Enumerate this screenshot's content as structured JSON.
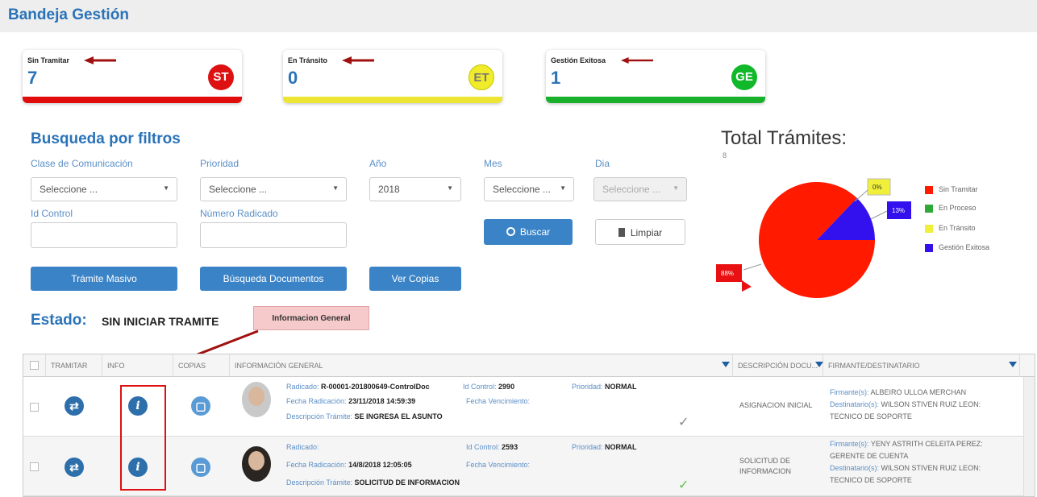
{
  "header": {
    "title": "Bandeja Gestión"
  },
  "cards": [
    {
      "label": "Sin Tramitar",
      "value": "7",
      "badge": "ST",
      "color": "#dd1111",
      "bar_color": "#e10d0d"
    },
    {
      "label": "En Tránsito",
      "value": "0",
      "badge": "ET",
      "color": "#f0ec2a",
      "bar_color": "#ece534"
    },
    {
      "label": "Gestión Exitosa",
      "value": "1",
      "badge": "GE",
      "color": "#11b82a",
      "bar_color": "#19b02c"
    }
  ],
  "filters": {
    "title": "Busqueda por filtros",
    "clase_label": "Clase de Comunicación",
    "clase_value": "Seleccione ...",
    "prioridad_label": "Prioridad",
    "prioridad_value": "Seleccione ...",
    "anio_label": "Año",
    "anio_value": "2018",
    "mes_label": "Mes",
    "mes_value": "Seleccione ...",
    "dia_label": "Dia",
    "dia_value": "Seleccione ...",
    "id_control_label": "Id Control",
    "numero_radicado_label": "Número Radicado",
    "buscar_label": "Buscar",
    "limpiar_label": "Limpiar",
    "tramite_masivo_label": "Trámite Masivo",
    "busqueda_docs_label": "Búsqueda Documentos",
    "ver_copias_label": "Ver Copias"
  },
  "estado": {
    "label": "Estado:",
    "value": "SIN INICIAR TRAMITE"
  },
  "info_tag": "Informacion General",
  "total": {
    "title": "Total Trámites:",
    "value": "8",
    "legend": [
      {
        "label": "Sin Tramitar",
        "color": "#ff1a00"
      },
      {
        "label": "En Proceso",
        "color": "#2ea836"
      },
      {
        "label": "En Tránsito",
        "color": "#f0f03a"
      },
      {
        "label": "Gestión Exitosa",
        "color": "#3311ee"
      }
    ],
    "slice_labels": {
      "sin_tramitar": "88%",
      "en_transito": "0%",
      "gestion_exitosa": "13%"
    },
    "chart_data": {
      "type": "pie",
      "categories": [
        "Sin Tramitar",
        "En Proceso",
        "En Tránsito",
        "Gestión Exitosa"
      ],
      "values": [
        88,
        0,
        0,
        13
      ]
    }
  },
  "grid": {
    "headers": [
      "TRAMITAR",
      "INFO",
      "COPIAS",
      "INFORMACIÓN GENERAL",
      "DESCRIPCIÓN DOCU...",
      "FIRMANTE/DESTINATARIO"
    ],
    "rows": [
      {
        "radicado_label": "Radicado:",
        "radicado_value": "R-00001-201800649-ControlDoc",
        "id_control_label": "Id Control:",
        "id_control_value": "2990",
        "prioridad_label": "Prioridad:",
        "prioridad_value": "NORMAL",
        "fecha_rad_label": "Fecha Radicación:",
        "fecha_rad_value": "23/11/2018 14:59:39",
        "fecha_venc_label": "Fecha Vencimiento:",
        "desc_tramite_label": "Descripción Trámite:",
        "desc_tramite_value": "SE INGRESA EL ASUNTO",
        "check_color": "#888888",
        "descripcion": "ASIGNACION INICIAL",
        "firmante_label": "Firmante(s):",
        "firmante_value": "ALBEIRO ULLOA MERCHAN",
        "destinatario_label": "Destinatario(s):",
        "destinatario_value": "WILSON STIVEN RUIZ LEON:",
        "cargo": "TECNICO DE SOPORTE"
      },
      {
        "radicado_label": "Radicado:",
        "radicado_value": "",
        "id_control_label": "Id Control:",
        "id_control_value": "2593",
        "prioridad_label": "Prioridad:",
        "prioridad_value": "NORMAL",
        "fecha_rad_label": "Fecha Radicación:",
        "fecha_rad_value": "14/8/2018 12:05:05",
        "fecha_venc_label": "Fecha Vencimiento:",
        "desc_tramite_label": "Descripción Trámite:",
        "desc_tramite_value": "SOLICITUD DE INFORMACION",
        "check_color": "#5cc545",
        "descripcion_1": "SOLICITUD DE",
        "descripcion_2": "INFORMACION",
        "firmante_label": "Firmante(s):",
        "firmante_value": "YENY ASTRITH CELEITA PEREZ:",
        "firmante_cargo": "GERENTE DE CUENTA",
        "destinatario_label": "Destinatario(s):",
        "destinatario_value": "WILSON STIVEN RUIZ LEON:",
        "cargo": "TECNICO DE SOPORTE"
      }
    ]
  },
  "icons": {
    "tramitar": "tramitar-icon",
    "info": "info-icon",
    "copias": "copy-icon",
    "search": "search-icon",
    "trash": "trash-icon",
    "check": "check-icon"
  }
}
